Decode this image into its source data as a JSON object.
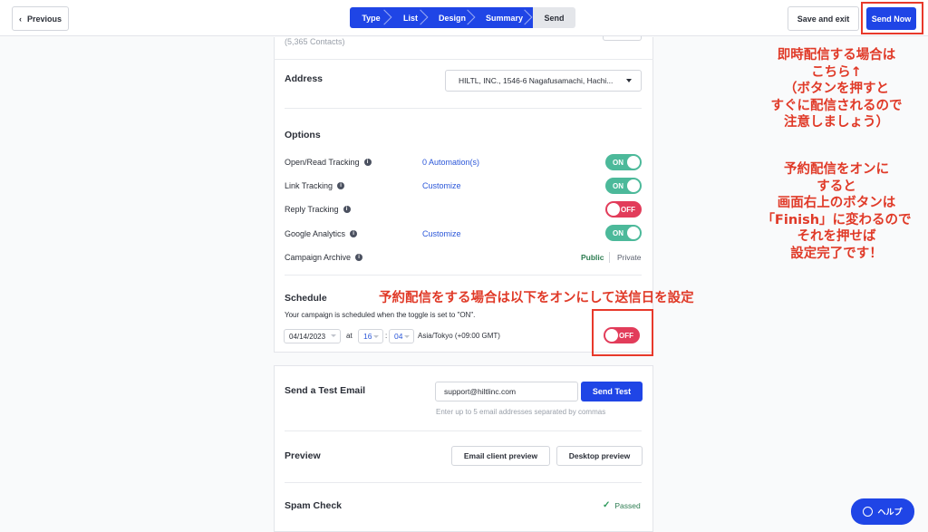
{
  "header": {
    "previous_label": "Previous",
    "previous_chevron": "‹",
    "steps": [
      "Type",
      "List",
      "Design",
      "Summary",
      "Send"
    ],
    "save_exit_label": "Save and exit",
    "send_now_label": "Send Now"
  },
  "recipients": {
    "contacts": "(5,365 Contacts)"
  },
  "address": {
    "title": "Address",
    "selected": "HILTL, INC., 1546-6 Nagafusamachi, Hachi..."
  },
  "options": {
    "title": "Options",
    "rows": [
      {
        "label": "Open/Read Tracking",
        "link": "0 Automation(s)",
        "toggle": "ON"
      },
      {
        "label": "Link Tracking",
        "link": "Customize",
        "toggle": "ON"
      },
      {
        "label": "Reply Tracking",
        "link": "",
        "toggle": "OFF"
      },
      {
        "label": "Google Analytics",
        "link": "Customize",
        "toggle": "ON"
      },
      {
        "label": "Campaign Archive",
        "public": "Public",
        "private": "Private"
      }
    ]
  },
  "schedule": {
    "title": "Schedule",
    "description": "Your campaign is scheduled when the toggle is set to \"ON\".",
    "date": "04/14/2023",
    "at": "at",
    "hour": "16",
    "colon": ":",
    "minute": "04",
    "timezone": "Asia/Tokyo (+09:00 GMT)",
    "toggle": "OFF"
  },
  "test_email": {
    "title": "Send a Test Email",
    "value": "support@hiltlinc.com",
    "button": "Send Test",
    "help": "Enter up to 5 email addresses separated by commas"
  },
  "preview": {
    "title": "Preview",
    "email_client_button": "Email client preview",
    "desktop_button": "Desktop preview"
  },
  "spam_check": {
    "title": "Spam Check",
    "status": "Passed"
  },
  "help_button": "ヘルプ",
  "annotations": {
    "right": [
      "即時配信する場合は",
      "こちら↑",
      "（ボタンを押すと",
      "すぐに配信されるので",
      "注意しましょう）",
      "",
      "予約配信をオンに",
      "すると",
      "画面右上のボタンは",
      "「Finish」に変わるので",
      "それを押せば",
      "設定完了です！"
    ],
    "schedule_note": "予約配信をする場合は以下をオンにして送信日を設定"
  },
  "colors": {
    "primary": "#1f45e6",
    "toggle_on": "#4cb99a",
    "toggle_off": "#e23c5a",
    "annotation": "#e03a28"
  }
}
